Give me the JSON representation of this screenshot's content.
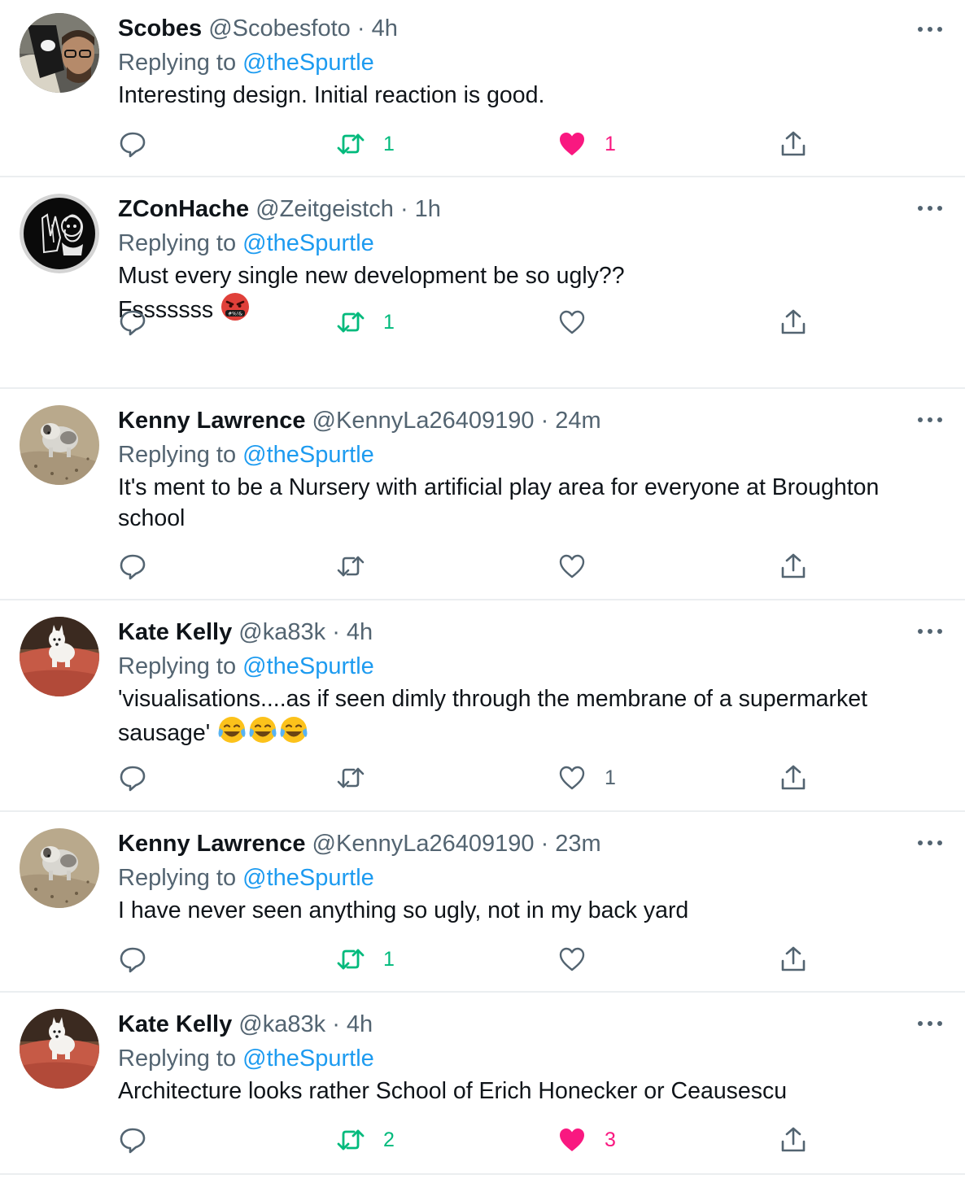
{
  "colors": {
    "accent": "#1d9bf0",
    "retweet": "#00ba7c",
    "like": "#f91880",
    "muted": "#536471",
    "divider": "#ebeef0"
  },
  "reply_prefix": "Replying to",
  "tweets": [
    {
      "name": "Scobes",
      "handle": "@Scobesfoto",
      "sep": "·",
      "time": "4h",
      "replying_to": "@theSpurtle",
      "lines": [
        "Interesting design. Initial reaction is good."
      ],
      "emoji": "",
      "retweets": "1",
      "retweeted": true,
      "likes": "1",
      "liked": true,
      "avatar_icon": "man-glasses-avatar"
    },
    {
      "name": "ZConHache",
      "handle": "@Zeitgeistch",
      "sep": "·",
      "time": "1h",
      "replying_to": "@theSpurtle",
      "lines": [
        "Must every single new development be so ugly??",
        "Fsssssss"
      ],
      "emoji": "cursing-face-emoji",
      "retweets": "1",
      "retweeted": true,
      "likes": "",
      "liked": false,
      "avatar_icon": "black-white-art-avatar"
    },
    {
      "name": "Kenny Lawrence",
      "handle": "@KennyLa26409190",
      "sep": "·",
      "time": "24m",
      "replying_to": "@theSpurtle",
      "lines": [
        "It's ment to be a Nursery with artificial play area for everyone at Broughton school"
      ],
      "emoji": "",
      "retweets": "",
      "retweeted": false,
      "likes": "",
      "liked": false,
      "avatar_icon": "dog-on-sand-avatar"
    },
    {
      "name": "Kate Kelly",
      "handle": "@ka83k",
      "sep": "·",
      "time": "4h",
      "replying_to": "@theSpurtle",
      "lines": [
        "'visualisations....as if seen dimly through the membrane of a supermarket sausage'"
      ],
      "emoji": "tears-of-joy-emoji-x3",
      "retweets": "",
      "retweeted": false,
      "likes": "1",
      "liked": false,
      "avatar_icon": "dog-on-sofa-avatar"
    },
    {
      "name": "Kenny Lawrence",
      "handle": "@KennyLa26409190",
      "sep": "·",
      "time": "23m",
      "replying_to": "@theSpurtle",
      "lines": [
        "I have never seen anything so ugly, not in my back yard"
      ],
      "emoji": "",
      "retweets": "1",
      "retweeted": true,
      "likes": "",
      "liked": false,
      "avatar_icon": "dog-on-sand-avatar"
    },
    {
      "name": "Kate Kelly",
      "handle": "@ka83k",
      "sep": "·",
      "time": "4h",
      "replying_to": "@theSpurtle",
      "lines": [
        "Architecture looks rather School of Erich Honecker or Ceausescu"
      ],
      "emoji": "",
      "retweets": "2",
      "retweeted": true,
      "likes": "3",
      "liked": true,
      "avatar_icon": "dog-on-sofa-avatar"
    }
  ]
}
